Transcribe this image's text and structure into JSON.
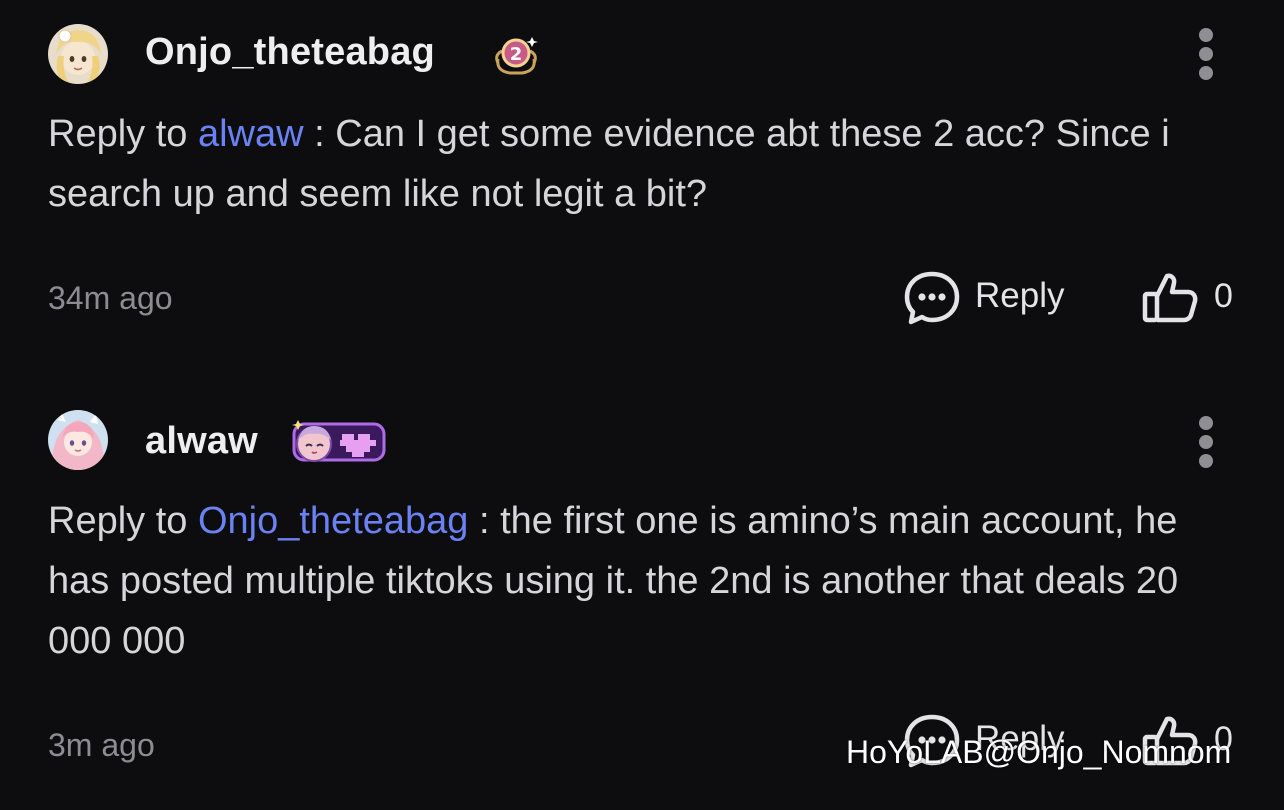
{
  "comments": [
    {
      "username": "Onjo_theteabag",
      "badge": {
        "icon": "level-2-badge-icon",
        "level": "2"
      },
      "reply_prefix": "Reply to ",
      "reply_target": "alwaw",
      "reply_sep": " : ",
      "text": "Can I get some evidence abt these 2 acc? Since i search up and seem like not legit a bit?",
      "time": "34m ago",
      "reply_label": "Reply",
      "likes": "0"
    },
    {
      "username": "alwaw",
      "badge": {
        "icon": "pixel-heart-badge-icon"
      },
      "reply_prefix": "Reply to ",
      "reply_target": "Onjo_theteabag",
      "reply_sep": " : ",
      "text": "the first one is amino’s main account, he has posted multiple tiktoks using it. the 2nd is another that deals 20 000 000",
      "time": "3m ago",
      "reply_label": "Reply",
      "likes": "0"
    }
  ],
  "watermark": "HoYoLAB@Onjo_Nomnom",
  "colors": {
    "background": "#0d0d10",
    "mention": "#6a82f3",
    "text": "#d5d5da",
    "muted": "#8c8c92",
    "badge_purple": "#9b4ddc"
  },
  "icons": {
    "reply": "chat-bubble-icon",
    "like": "thumbs-up-icon",
    "more": "more-vertical-icon"
  }
}
